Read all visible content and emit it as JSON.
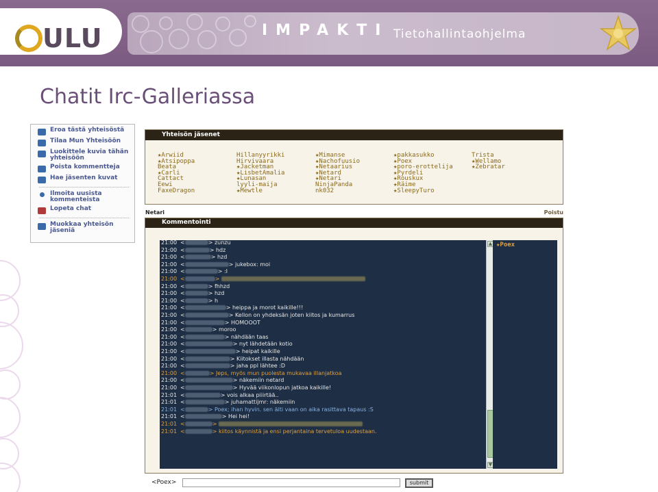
{
  "header": {
    "logo_text": "ULU",
    "brand": "IMPAKTI",
    "dash": "-",
    "subtitle": "Tietohallintaohjelma",
    "accent_color": "#7a5a80"
  },
  "page_title": "Chatit Irc-Galleriassa",
  "sidebar": {
    "items": [
      {
        "label": "Eroa tästä yhteisöstä",
        "icon": "leave-icon"
      },
      {
        "label": "Tilaa Mun Yhteisöön",
        "icon": "subscribe-icon"
      },
      {
        "label": "Luokittele kuvia tähän yhteisöön",
        "icon": "categorize-icon"
      },
      {
        "label": "Poista kommentteja",
        "icon": "delete-comment-icon"
      },
      {
        "label": "Hae jäsenten kuvat",
        "icon": "fetch-images-icon"
      },
      {
        "label": "Ilmoita uusista kommenteista",
        "icon": "notify-icon"
      },
      {
        "label": "Lopeta chat",
        "icon": "stop-chat-icon"
      },
      {
        "label": "Muokkaa yhteisön jäseniä",
        "icon": "edit-members-icon"
      }
    ]
  },
  "members": {
    "title": "Yhteisön jäsenet",
    "columns": [
      [
        "★Arwiid",
        "★Atsipoppa",
        " Beata",
        "★Carli",
        " Cattact",
        " Eewi",
        " FaxeDragon"
      ],
      [
        " Hillanyyrikki",
        " Hirvivaara",
        "★Jacketman",
        "★LisbetAmalia",
        "★Lunasan",
        " lyyli-maija",
        "★Mewtle"
      ],
      [
        "★Mimanse",
        "★Nachofuusio",
        "★Netaarius",
        "★Netard",
        "★Netari",
        " NinjaPanda",
        " nk032"
      ],
      [
        "★pakkasukko",
        "★Poex",
        "★poro-erottelija",
        "★Pyrdeli",
        "★Rouskux",
        "★Räime",
        "★SleepyTuro"
      ],
      [
        " Trista",
        "★Wellamo",
        "★Zebratar"
      ]
    ]
  },
  "channel": {
    "name": "Netari",
    "leave_label": "Poistu"
  },
  "comments": {
    "title": "Kommentointi",
    "lines": [
      {
        "time": "21:00",
        "text": "zunzu",
        "color": "white"
      },
      {
        "time": "21:00",
        "text": "hdz",
        "color": "white"
      },
      {
        "time": "21:00",
        "text": "hzd",
        "color": "white"
      },
      {
        "time": "21:00",
        "text": "jukebox: moi",
        "color": "white"
      },
      {
        "time": "21:00",
        "text": ":I",
        "color": "white"
      },
      {
        "time": "21:00",
        "text": "",
        "color": "orange"
      },
      {
        "time": "21:00",
        "text": "fhhzd",
        "color": "white"
      },
      {
        "time": "21:00",
        "text": "hzd",
        "color": "white"
      },
      {
        "time": "21:00",
        "text": "h",
        "color": "white"
      },
      {
        "time": "21:00",
        "text": "heippa ja morot kaikille!!!",
        "color": "white"
      },
      {
        "time": "21:00",
        "text": "Kellon on yhdeksän joten kiitos ja kumarrus",
        "color": "white"
      },
      {
        "time": "21:00",
        "text": "HOMOOOT",
        "color": "white"
      },
      {
        "time": "21:00",
        "text": "moroo",
        "color": "white"
      },
      {
        "time": "21:00",
        "text": "nähdään taas",
        "color": "white"
      },
      {
        "time": "21:00",
        "text": "nyt lähdetään kotio",
        "color": "white"
      },
      {
        "time": "21:00",
        "text": "heipat kaikille",
        "color": "white"
      },
      {
        "time": "21:00",
        "text": "Kiitokset illasta nähdään",
        "color": "white"
      },
      {
        "time": "21:00",
        "text": "jaha ppl lähtee :D",
        "color": "white"
      },
      {
        "time": "21:00",
        "text": "Jeps, myös mun puolesta mukavaa illanjatkoa",
        "color": "orange"
      },
      {
        "time": "21:00",
        "text": "näkemiin netard",
        "color": "white"
      },
      {
        "time": "21:00",
        "text": "Hyvää viikonlopun jatkoa kaikille!",
        "color": "white"
      },
      {
        "time": "21:01",
        "text": "vois alkaa piiirtää..",
        "color": "white"
      },
      {
        "time": "21:01",
        "text": "juhamattijmr: näkemiin",
        "color": "white"
      },
      {
        "time": "21:01",
        "text": "Poex; ihan hyvin. sen äiti vaan on aika rasittava tapaus :S",
        "color": "blue"
      },
      {
        "time": "21:01",
        "text": "Hei hei!",
        "color": "white"
      },
      {
        "time": "21:01",
        "text": "",
        "color": "orange"
      },
      {
        "time": "21:01",
        "text": "kiitos käynnistä ja ensi perjantaina tervetuloa uudestaan.",
        "color": "orange"
      }
    ],
    "online_users": [
      "★Poex"
    ]
  },
  "input": {
    "nick": "<Poex>",
    "value": "",
    "submit_label": "submit"
  }
}
